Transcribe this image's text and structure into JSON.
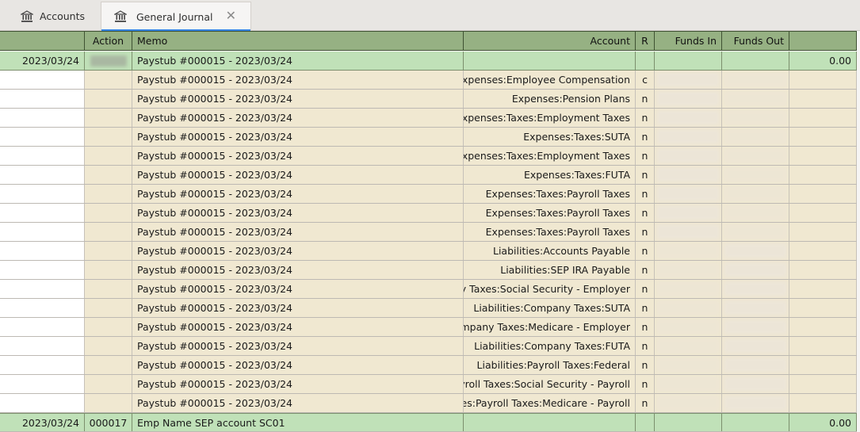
{
  "tabs": [
    {
      "label": "Accounts",
      "icon": "bank-icon",
      "active": false
    },
    {
      "label": "General Journal",
      "icon": "bank-icon",
      "active": true,
      "closable": true
    }
  ],
  "colors": {
    "header_bg": "#96b183",
    "txn_row_bg": "#c0e1b8",
    "split_row_bg": "#f0e8d1",
    "active_tab_underline": "#3584e4"
  },
  "columns": {
    "date": "",
    "action": "Action",
    "memo": "Memo",
    "account": "Account",
    "reconcile": "R",
    "funds_in": "Funds In",
    "funds_out": "Funds Out",
    "balance": ""
  },
  "transaction": {
    "date": "2023/03/24",
    "action": "",
    "description": "Paystub #000015 - 2023/03/24",
    "balance": "0.00"
  },
  "splits": [
    {
      "memo": "Paystub #000015 - 2023/03/24",
      "account": "Expenses:Employee Compensation",
      "r": "c",
      "side": "in"
    },
    {
      "memo": "Paystub #000015 - 2023/03/24",
      "account": "Expenses:Pension Plans",
      "r": "n",
      "side": "in"
    },
    {
      "memo": "Paystub #000015 - 2023/03/24",
      "account": "Expenses:Taxes:Employment Taxes",
      "r": "n",
      "side": "in"
    },
    {
      "memo": "Paystub #000015 - 2023/03/24",
      "account": "Expenses:Taxes:SUTA",
      "r": "n",
      "side": "in"
    },
    {
      "memo": "Paystub #000015 - 2023/03/24",
      "account": "Expenses:Taxes:Employment Taxes",
      "r": "n",
      "side": "in"
    },
    {
      "memo": "Paystub #000015 - 2023/03/24",
      "account": "Expenses:Taxes:FUTA",
      "r": "n",
      "side": "in"
    },
    {
      "memo": "Paystub #000015 - 2023/03/24",
      "account": "Expenses:Taxes:Payroll Taxes",
      "r": "n",
      "side": "in"
    },
    {
      "memo": "Paystub #000015 - 2023/03/24",
      "account": "Expenses:Taxes:Payroll Taxes",
      "r": "n",
      "side": "in"
    },
    {
      "memo": "Paystub #000015 - 2023/03/24",
      "account": "Expenses:Taxes:Payroll Taxes",
      "r": "n",
      "side": "in"
    },
    {
      "memo": "Paystub #000015 - 2023/03/24",
      "account": "Liabilities:Accounts Payable",
      "r": "n",
      "side": "out"
    },
    {
      "memo": "Paystub #000015 - 2023/03/24",
      "account": "Liabilities:SEP IRA Payable",
      "r": "n",
      "side": "out"
    },
    {
      "memo": "Paystub #000015 - 2023/03/24",
      "account": "ny Taxes:Social Security - Employer",
      "r": "n",
      "side": "out"
    },
    {
      "memo": "Paystub #000015 - 2023/03/24",
      "account": "Liabilities:Company Taxes:SUTA",
      "r": "n",
      "side": "out"
    },
    {
      "memo": "Paystub #000015 - 2023/03/24",
      "account": "ompany Taxes:Medicare - Employer",
      "r": "n",
      "side": "out"
    },
    {
      "memo": "Paystub #000015 - 2023/03/24",
      "account": "Liabilities:Company Taxes:FUTA",
      "r": "n",
      "side": "out"
    },
    {
      "memo": "Paystub #000015 - 2023/03/24",
      "account": "Liabilities:Payroll Taxes:Federal",
      "r": "n",
      "side": "out"
    },
    {
      "memo": "Paystub #000015 - 2023/03/24",
      "account": "ayroll Taxes:Social Security - Payroll",
      "r": "n",
      "side": "out"
    },
    {
      "memo": "Paystub #000015 - 2023/03/24",
      "account": "ties:Payroll Taxes:Medicare - Payroll",
      "r": "n",
      "side": "out"
    }
  ],
  "next_transaction": {
    "date": "2023/03/24",
    "action": "000017",
    "description": "Emp Name SEP account SC01",
    "balance": "0.00"
  }
}
